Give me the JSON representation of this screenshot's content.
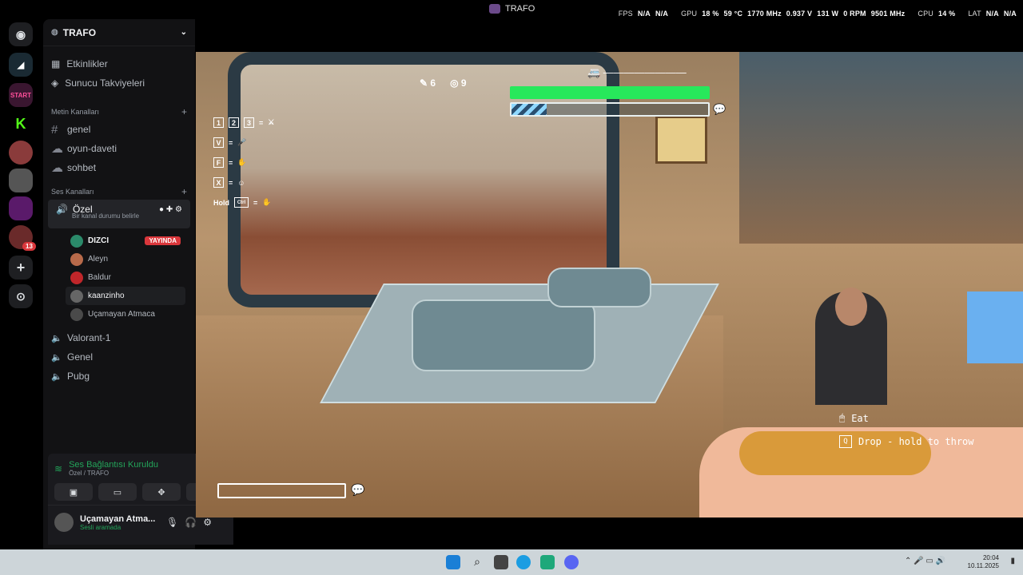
{
  "window": {
    "title": "TRAFO"
  },
  "metrics": {
    "fps_label": "FPS",
    "fps_1": "N/A",
    "fps_2": "N/A",
    "gpu_label": "GPU",
    "gpu_load": "18 %",
    "gpu_temp": "59 °C",
    "gpu_clock": "1770 MHz",
    "gpu_volt": "0.937 V",
    "gpu_power": "131 W",
    "gpu_fan": "0 RPM",
    "gpu_mem": "9501 MHz",
    "cpu_label": "CPU",
    "cpu_load": "14 %",
    "lat_label": "LAT",
    "lat_1": "N/A",
    "lat_2": "N/A"
  },
  "server": {
    "name": "TRAFO",
    "events": "Etkinlikler",
    "boosts": "Sunucu Takviyeleri",
    "text_category": "Metin Kanalları",
    "text_channels": [
      "genel",
      "oyun-daveti",
      "sohbet"
    ],
    "voice_category": "Ses Kanalları",
    "active_voice": {
      "name": "Özel",
      "status_hint": "Bir kanal durumu belirle"
    },
    "voice_users": [
      {
        "name": "DIZCI",
        "badge": "YAYINDA"
      },
      {
        "name": "Aleyn"
      },
      {
        "name": "Baldur"
      },
      {
        "name": "kaanzinho"
      },
      {
        "name": "Uçamayan Atmaca"
      }
    ],
    "voice_channels": [
      "Valorant-1",
      "Genel",
      "Pubg"
    ]
  },
  "rail": {
    "badge_count": "13"
  },
  "voice_panel": {
    "status": "Ses Bağlantısı Kuruldu",
    "location": "Özel / TRAFO"
  },
  "user_panel": {
    "name": "Uçamayan Atma...",
    "status": "Sesli aramada"
  },
  "game": {
    "hud_counts": [
      "6",
      "9"
    ],
    "stamina_fraction": 0.18,
    "keys": [
      "1",
      "2",
      "3",
      "V",
      "F",
      "X"
    ],
    "hold_label": "Hold",
    "hold_key": "Ctrl",
    "hints": [
      {
        "key": "🖱",
        "text": "Eat"
      },
      {
        "key": "Q",
        "text": "Drop - hold to throw"
      }
    ]
  },
  "clock": {
    "time": "20:04",
    "date": "10.11.2025"
  },
  "colors": {
    "accent_green": "#27e85b",
    "live_red": "#da373c",
    "voice_green": "#23a55a"
  }
}
